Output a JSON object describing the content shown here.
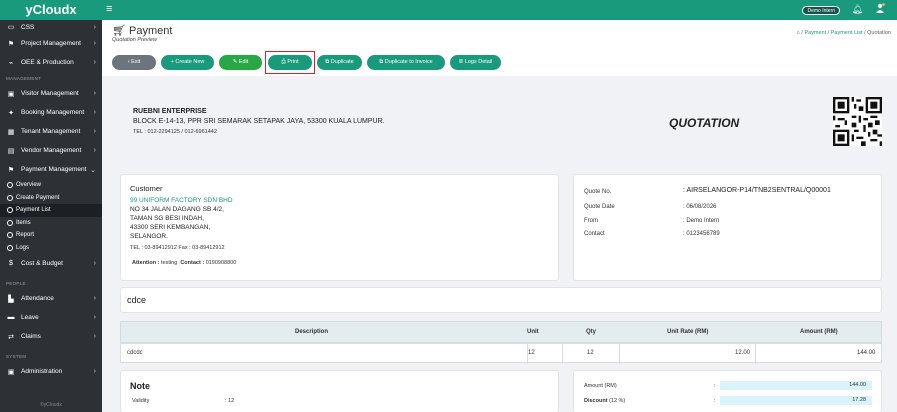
{
  "app": {
    "brand": "yCloudx"
  },
  "sidebar": {
    "items_top": [
      {
        "label": "CSS",
        "icon": "box-icon"
      },
      {
        "label": "Project Management",
        "icon": "flag-icon"
      },
      {
        "label": "OEE & Production",
        "icon": "chart-icon"
      }
    ],
    "section_management": "MANAGEMENT",
    "items_mgmt": [
      {
        "label": "Visitor Management",
        "icon": "idcard-icon"
      },
      {
        "label": "Booking Management",
        "icon": "pin-icon"
      },
      {
        "label": "Tenant Management",
        "icon": "building-icon"
      },
      {
        "label": "Vendor Management",
        "icon": "vendor-icon"
      },
      {
        "label": "Payment Management",
        "icon": "flag-icon"
      }
    ],
    "payment_sub": [
      {
        "label": "Overview"
      },
      {
        "label": "Create Payment"
      },
      {
        "label": "Payment List"
      },
      {
        "label": "Items"
      },
      {
        "label": "Report"
      },
      {
        "label": "Logs"
      }
    ],
    "cost_budget": {
      "label": "Cost & Budget",
      "icon": "dollar-icon"
    },
    "section_people": "PEOPLE",
    "items_people": [
      {
        "label": "Attendance",
        "icon": "calendar-icon"
      },
      {
        "label": "Leave",
        "icon": "car-icon"
      },
      {
        "label": "Claims",
        "icon": "swap-icon"
      }
    ],
    "section_system": "SYSTEM",
    "items_system": [
      {
        "label": "Administration",
        "icon": "admin-icon"
      }
    ],
    "footer": "©yCloudx"
  },
  "topbar": {
    "user_badge": "Demo Intern"
  },
  "header": {
    "title": "Payment",
    "subtitle": "Quotation Preview",
    "breadcrumbs": [
      "Payment",
      "Payment List",
      "Quotation"
    ]
  },
  "toolbar": {
    "exit": "Exit",
    "create_new": "Create New",
    "edit": "Edit",
    "print": "Print",
    "duplicate": "Duplicate",
    "duplicate_invoice": "Duplicate to Invoice",
    "logs_detail": "Logs Detail"
  },
  "company": {
    "name": "RUEBNI ENTERPRISE",
    "address": "BLOCK E-14-13, PPR SRI SEMARAK SETAPAK JAYA, 53300 KUALA LUMPUR.",
    "tel": "TEL : 012-2294125 / 012-6961442"
  },
  "doc_title": "QUOTATION",
  "customer": {
    "heading": "Customer",
    "name": "99 UNIFORM FACTORY SDN BHD",
    "address_lines": [
      "NO 34 JALAN DAGANG SB 4/2,",
      "TAMAN SG BESI INDAH,",
      "43300 SERI KEMBANGAN,",
      "SELANGOR."
    ],
    "tel_fax": "TEL : 03-89412912   Fax : 03-89412912",
    "attention_label": "Attention :",
    "attention_value": "testing",
    "contact_label": "Contact :",
    "contact_value": "0190908800"
  },
  "quote_info": {
    "quote_no_label": "Quote No.",
    "quote_no_value": ": AIRSELANGOR-P14/TNB2SENTRAL/Q00001",
    "date_label": "Quote Date",
    "date_value": ": 06/08/2026",
    "from_label": "From",
    "from_value": ": Demo Intern",
    "contact_label": "Contact",
    "contact_value": ": 0123456789"
  },
  "subject": "cdce",
  "table": {
    "headers": [
      "Description",
      "Unit",
      "Qty",
      "Unit Rate (RM)",
      "Amount (RM)"
    ],
    "rows": [
      {
        "description": "cdcdc",
        "unit": "12",
        "qty": "12",
        "unit_rate": "12.00",
        "amount": "144.00"
      }
    ]
  },
  "note": {
    "heading": "Note",
    "validity_label": "Validity",
    "validity_value": ": 12"
  },
  "totals": {
    "amount_label": "Amount",
    "amount_unit": "(RM)",
    "amount_value": "144.00",
    "discount_label": "Discount",
    "discount_pct": "(12 %)",
    "discount_value": "17.28",
    "colon": ":"
  }
}
